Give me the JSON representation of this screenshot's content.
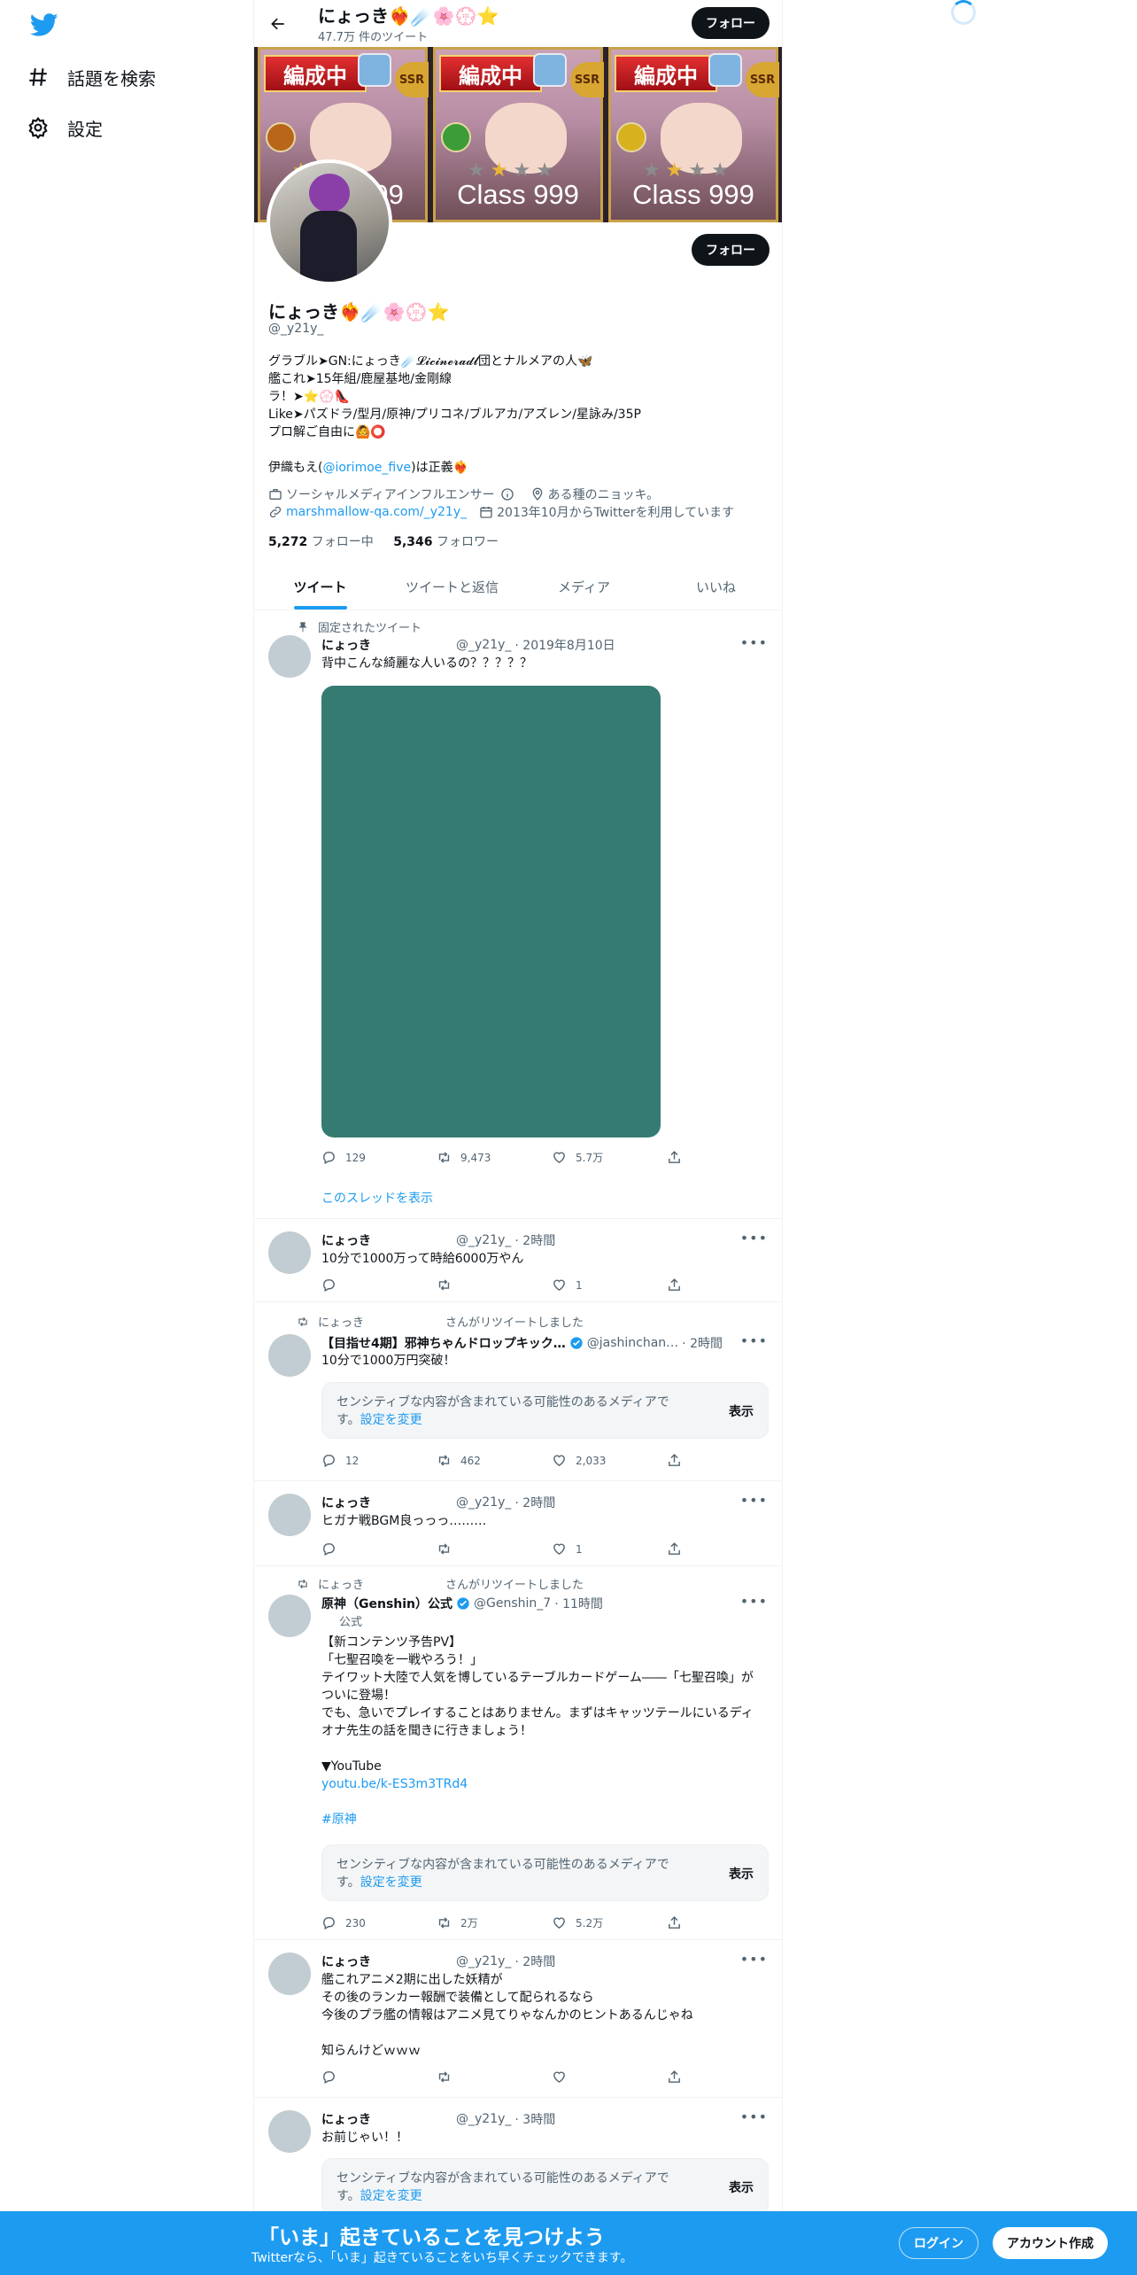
{
  "nav": {
    "explore_label": "話題を検索",
    "settings_label": "設定"
  },
  "profile": {
    "display_name": "にょっき❤️‍🔥☄️🌸💮⭐",
    "tweet_count": "47.7万 件のツイート",
    "handle": "@_y21y_",
    "follow_label": "フォロー",
    "bio": "グラブル➤GN:にょっき☄️𝓛𝓲𝓬𝓲𝓷𝓮𝓻𝓪𝓭𝓵団とナルメアの人🦋\n艦これ➤15年組/鹿屋基地/金剛線\nラ！➤⭐💮👠\nLike➤パズドラ/型月/原神/プリコネ/ブルアカ/アズレン/星詠み/35P\nプロ解ご自由に🙆⭕",
    "bio_line2_prefix": "伊織もえ(",
    "bio_line2_link": "@iorimoe_five",
    "bio_line2_suffix": ")は正義❤️‍🔥",
    "category": "ソーシャルメディアインフルエンサー",
    "location": "ある種のニョッキ。",
    "url": "marshmallow-qa.com/_y21y_",
    "joined": "2013年10月からTwitterを利用しています",
    "following_count": "5,272",
    "following_label": "フォロー中",
    "followers_count": "5,346",
    "followers_label": "フォロワー"
  },
  "banner": {
    "cards": [
      {
        "tag": "編成中",
        "ssr": "SSR",
        "class_text": "Class 999",
        "element_color": "#b8661a"
      },
      {
        "tag": "編成中",
        "ssr": "SSR",
        "class_text": "Class 999",
        "element_color": "#3c9c37"
      },
      {
        "tag": "編成中",
        "ssr": "SSR",
        "class_text": "Class 999",
        "element_color": "#d7b21e"
      }
    ]
  },
  "tabs": [
    "ツイート",
    "ツイートと返信",
    "メディア",
    "いいね"
  ],
  "tweets": [
    {
      "context": "固定されたツイート",
      "name": "にょっき",
      "handle": "@_y21y_",
      "time": "· 2019年8月10日",
      "text": "背中こんな綺麗な人いるの？？？？？",
      "replies": "129",
      "retweets": "9,473",
      "likes": "5.7万",
      "show_thread": "このスレッドを表示"
    },
    {
      "name": "にょっき",
      "handle": "@_y21y_",
      "time": "· 2時間",
      "text": "10分で1000万って時給6000万やん",
      "replies": "",
      "retweets": "",
      "likes": "1"
    },
    {
      "context_name": "にょっき",
      "context": "さんがリツイートしました",
      "name": "【目指せ4期】邪神ちゃんドロップキック…",
      "handle": "@jashinchan…",
      "time": "· 2時間",
      "text": "10分で1000万円突破！",
      "sensitive_text": "センシティブな内容が含まれている可能性のあるメディアです。",
      "sensitive_link": "設定を変更",
      "sensitive_button": "表示",
      "replies": "12",
      "retweets": "462",
      "likes": "2,033"
    },
    {
      "name": "にょっき",
      "handle": "@_y21y_",
      "time": "· 2時間",
      "text": "ヒガナ戦BGM良っっっ………",
      "replies": "",
      "retweets": "",
      "likes": "1"
    },
    {
      "context_name": "にょっき",
      "context": "さんがリツイートしました",
      "name": "原神（Genshin）公式",
      "handle": "@Genshin_7",
      "time": "· 11時間",
      "official_label": "公式",
      "text": "【新コンテンツ予告PV】\n「七聖召喚を一戦やろう！」\nテイワット大陸で人気を博しているテーブルカードゲーム――「七聖召喚」がついに登場！\nでも、急いでプレイすることはありません。まずはキャッツテールにいるディオナ先生の話を聞きに行きましょう！\n\n▼YouTube",
      "link": "youtu.be/k-ES3m3TRd4",
      "hashtag": "#原神",
      "sensitive_text": "センシティブな内容が含まれている可能性のあるメディアです。",
      "sensitive_link": "設定を変更",
      "sensitive_button": "表示",
      "replies": "230",
      "retweets": "2万",
      "likes": "5.2万"
    },
    {
      "name": "にょっき",
      "handle": "@_y21y_",
      "time": "· 2時間",
      "text": "艦これアニメ2期に出した妖精が\nその後のランカー報酬で装備として配られるなら\n今後のプラ艦の情報はアニメ見てりゃなんかのヒントあるんじゃね\n\n知らんけどｗｗｗ",
      "replies": "",
      "retweets": "",
      "likes": ""
    },
    {
      "name": "にょっき",
      "handle": "@_y21y_",
      "time": "· 3時間",
      "text": "お前じゃい！！",
      "sensitive_text": "センシティブな内容が含まれている可能性のあるメディアです。",
      "sensitive_link": "設定を変更",
      "sensitive_button": "表示"
    }
  ],
  "bottom_bar": {
    "title": "「いま」起きていることを見つけよう",
    "subtitle": "Twitterなら、「いま」起きていることをいち早くチェックできます。",
    "login_label": "ログイン",
    "signup_label": "アカウント作成"
  },
  "colors": {
    "accent": "#1d9bf0",
    "text": "#0f1419",
    "secondary_text": "#536471",
    "media_placeholder": "#357b71",
    "avatar_placeholder": "#c2ccd3"
  }
}
